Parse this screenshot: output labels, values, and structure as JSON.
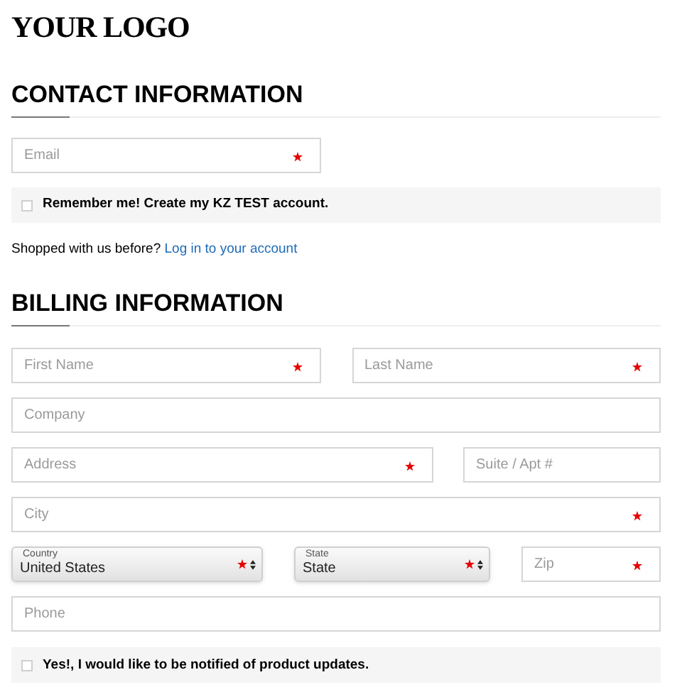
{
  "logo": "YOUR LOGO",
  "contact": {
    "heading": "CONTACT INFORMATION",
    "fields": [
      {
        "kind": "input",
        "placeholder": "Email",
        "required": true
      }
    ],
    "remember": {
      "label": "Remember me! Create my KZ TEST account.",
      "checked": false
    },
    "login_prompt": "Shopped with us before?",
    "login_link": "Log in to your account"
  },
  "billing": {
    "heading": "BILLING INFORMATION",
    "rows": [
      {
        "fields": [
          {
            "kind": "input",
            "placeholder": "First Name",
            "required": true
          },
          {
            "kind": "input",
            "placeholder": "Last Name",
            "required": true
          }
        ]
      },
      {
        "fields": [
          {
            "kind": "input",
            "placeholder": "Company",
            "required": false
          }
        ]
      },
      {
        "fields": [
          {
            "kind": "input",
            "placeholder": "Address",
            "required": true
          },
          {
            "kind": "input",
            "placeholder": "Suite / Apt #",
            "required": false
          }
        ]
      },
      {
        "fields": [
          {
            "kind": "input",
            "placeholder": "City",
            "required": true
          }
        ]
      },
      {
        "fields": [
          {
            "kind": "select",
            "label": "Country",
            "value": "United States",
            "required": true
          },
          {
            "kind": "select",
            "label": "State",
            "value": "State",
            "required": true
          },
          {
            "kind": "input",
            "placeholder": "Zip",
            "required": true
          }
        ]
      },
      {
        "fields": [
          {
            "kind": "input",
            "placeholder": "Phone",
            "required": false
          }
        ]
      }
    ],
    "updates": {
      "label": "Yes!, I would like to be notified of product updates.",
      "checked": false
    }
  }
}
